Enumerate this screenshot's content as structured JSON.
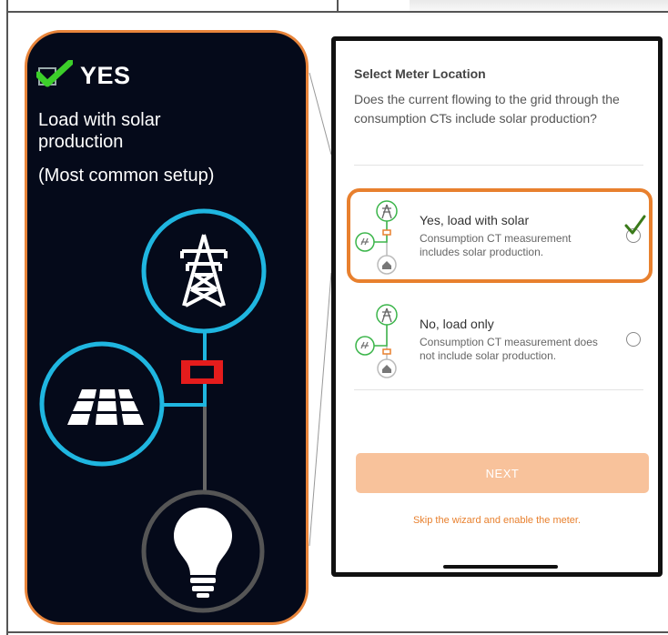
{
  "left_card": {
    "yes_label": "YES",
    "load_label": "Load with solar production",
    "common_label": "(Most common setup)"
  },
  "phone": {
    "title": "Select Meter Location",
    "question": "Does the current flowing to the grid through the consumption CTs include solar production?",
    "options": [
      {
        "title": "Yes, load with solar",
        "description": "Consumption CT measurement includes solar production.",
        "selected": true
      },
      {
        "title": "No, load only",
        "description": "Consumption CT measurement does not include solar production.",
        "selected": false
      }
    ],
    "next_label": "NEXT",
    "skip_label": "Skip the wizard and enable the meter."
  },
  "colors": {
    "accent_orange": "#e8802e",
    "dark_bg": "#050a1a",
    "cyan": "#1fb6e0",
    "green_check": "#3ccf2a",
    "mini_green": "#3bb54a"
  },
  "icons": [
    "check-icon",
    "transmission-tower-icon",
    "solar-panel-icon",
    "lightbulb-icon",
    "meter-icon",
    "home-icon"
  ]
}
